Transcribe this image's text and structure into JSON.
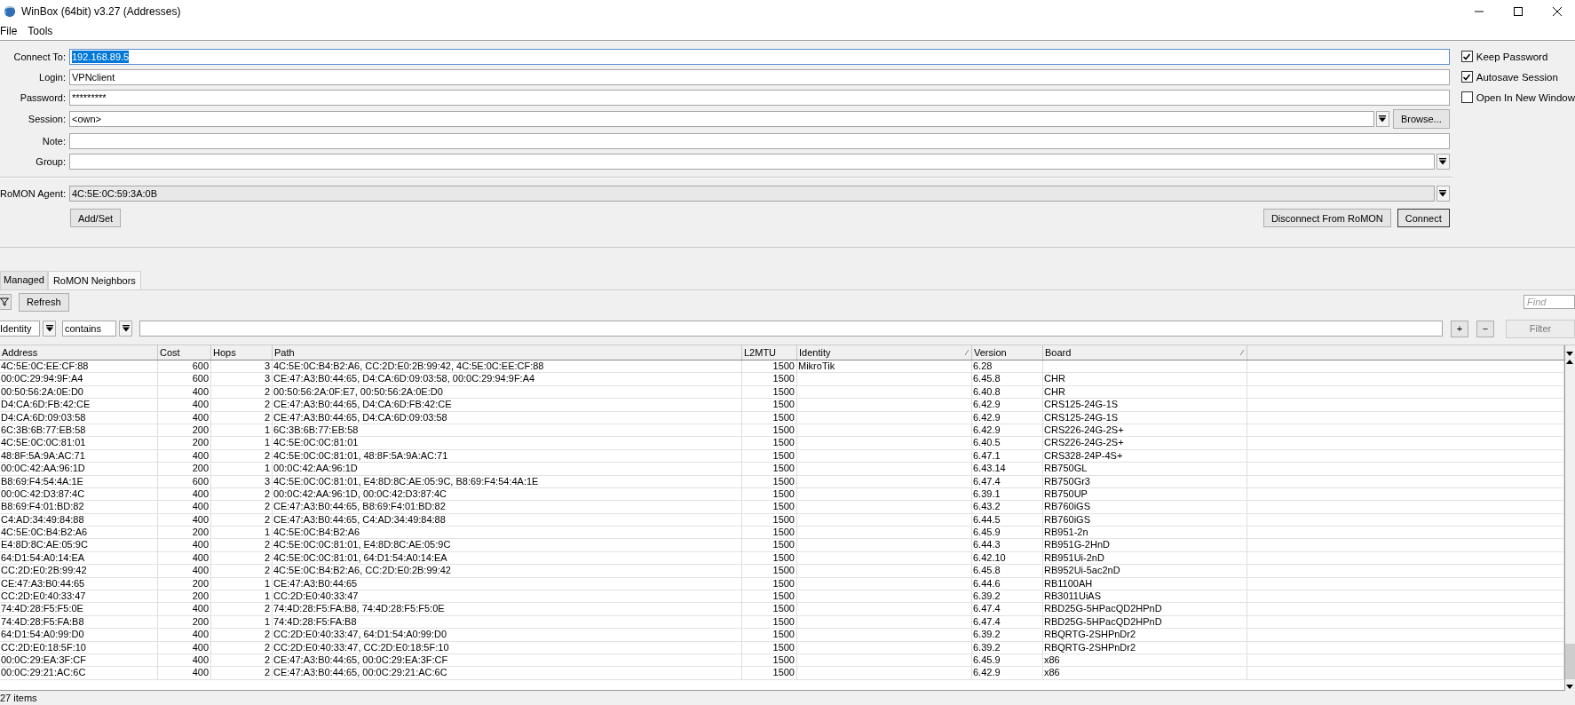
{
  "window": {
    "title": "WinBox (64bit) v3.27 (Addresses)"
  },
  "menu": [
    "File",
    "Tools"
  ],
  "form": {
    "fields": [
      {
        "label": "Connect To:",
        "value": "192.168.89.5",
        "kind": "text",
        "highlighted": true,
        "disabled": false
      },
      {
        "label": "Login:",
        "value": "VPNclient",
        "kind": "text",
        "highlighted": false,
        "disabled": false
      },
      {
        "label": "Password:",
        "value": "*********",
        "kind": "text",
        "highlighted": false,
        "disabled": false
      },
      {
        "label": "Session:",
        "value": "<own>",
        "kind": "browse",
        "button": "Browse...",
        "highlighted": false,
        "disabled": false
      },
      {
        "label": "Note:",
        "kind": "text",
        "highlighted": false,
        "disabled": false
      },
      {
        "label": "Group:",
        "kind": "dropdown",
        "highlighted": false,
        "disabled": false
      },
      {
        "label": "RoMON Agent:",
        "value": "4C:5E:0C:59:3A:0B",
        "kind": "dropdown",
        "highlighted": false,
        "disabled": true
      }
    ],
    "options": [
      {
        "label": "Keep Password",
        "checked": true
      },
      {
        "label": "Autosave Session",
        "checked": true
      },
      {
        "label": "Open In New Window",
        "checked": false
      }
    ],
    "left_buttons": [
      {
        "label": "Add/Set",
        "default": false
      }
    ],
    "right_buttons": [
      {
        "label": "Disconnect From RoMON",
        "default": false
      },
      {
        "label": "Connect",
        "default": true
      }
    ]
  },
  "tabs": [
    {
      "label": "Managed",
      "selected": false
    },
    {
      "label": "RoMON Neighbors",
      "selected": true
    }
  ],
  "toolbar": {
    "refresh": "Refresh",
    "find": {
      "placeholder": "Find"
    }
  },
  "filter": {
    "column": "Identity",
    "operator": "contains",
    "add": "+",
    "remove": "−",
    "apply": {
      "label": "Filter",
      "disabled": true
    }
  },
  "table": {
    "columns": [
      {
        "label": "Address",
        "sorted": false
      },
      {
        "label": "Cost",
        "sorted": false
      },
      {
        "label": "Hops",
        "sorted": false
      },
      {
        "label": "Path",
        "sorted": false
      },
      {
        "label": "L2MTU",
        "sorted": false
      },
      {
        "label": "Identity",
        "sorted": true
      },
      {
        "label": "Version",
        "sorted": false
      },
      {
        "label": "Board",
        "sorted": true
      }
    ],
    "rows": [
      [
        "4C:5E:0C:EE:CF:88",
        "600",
        "3",
        "4C:5E:0C:B4:B2:A6, CC:2D:E0:2B:99:42, 4C:5E:0C:EE:CF:88",
        "1500",
        "MikroTik",
        "6.28",
        ""
      ],
      [
        "00:0C:29:94:9F:A4",
        "600",
        "3",
        "CE:47:A3:B0:44:65, D4:CA:6D:09:03:58, 00:0C:29:94:9F:A4",
        "1500",
        "",
        "6.45.8",
        "CHR"
      ],
      [
        "00:50:56:2A:0E:D0",
        "400",
        "2",
        "00:50:56:2A:0F:E7, 00:50:56:2A:0E:D0",
        "1500",
        "",
        "6.40.8",
        "CHR"
      ],
      [
        "D4:CA:6D:FB:42:CE",
        "400",
        "2",
        "CE:47:A3:B0:44:65, D4:CA:6D:FB:42:CE",
        "1500",
        "",
        "6.42.9",
        "CRS125-24G-1S"
      ],
      [
        "D4:CA:6D:09:03:58",
        "400",
        "2",
        "CE:47:A3:B0:44:65, D4:CA:6D:09:03:58",
        "1500",
        "",
        "6.42.9",
        "CRS125-24G-1S"
      ],
      [
        "6C:3B:6B:77:EB:58",
        "200",
        "1",
        "6C:3B:6B:77:EB:58",
        "1500",
        "",
        "6.42.9",
        "CRS226-24G-2S+"
      ],
      [
        "4C:5E:0C:0C:81:01",
        "200",
        "1",
        "4C:5E:0C:0C:81:01",
        "1500",
        "",
        "6.40.5",
        "CRS226-24G-2S+"
      ],
      [
        "48:8F:5A:9A:AC:71",
        "400",
        "2",
        "4C:5E:0C:0C:81:01, 48:8F:5A:9A:AC:71",
        "1500",
        "",
        "6.47.1",
        "CRS328-24P-4S+"
      ],
      [
        "00:0C:42:AA:96:1D",
        "200",
        "1",
        "00:0C:42:AA:96:1D",
        "1500",
        "",
        "6.43.14",
        "RB750GL"
      ],
      [
        "B8:69:F4:54:4A:1E",
        "600",
        "3",
        "4C:5E:0C:0C:81:01, E4:8D:8C:AE:05:9C, B8:69:F4:54:4A:1E",
        "1500",
        "",
        "6.47.4",
        "RB750Gr3"
      ],
      [
        "00:0C:42:D3:87:4C",
        "400",
        "2",
        "00:0C:42:AA:96:1D, 00:0C:42:D3:87:4C",
        "1500",
        "",
        "6.39.1",
        "RB750UP"
      ],
      [
        "B8:69:F4:01:BD:82",
        "400",
        "2",
        "CE:47:A3:B0:44:65, B8:69:F4:01:BD:82",
        "1500",
        "",
        "6.43.2",
        "RB760iGS"
      ],
      [
        "C4:AD:34:49:84:88",
        "400",
        "2",
        "CE:47:A3:B0:44:65, C4:AD:34:49:84:88",
        "1500",
        "",
        "6.44.5",
        "RB760iGS"
      ],
      [
        "4C:5E:0C:B4:B2:A6",
        "200",
        "1",
        "4C:5E:0C:B4:B2:A6",
        "1500",
        "",
        "6.45.9",
        "RB951-2n"
      ],
      [
        "E4:8D:8C:AE:05:9C",
        "400",
        "2",
        "4C:5E:0C:0C:81:01, E4:8D:8C:AE:05:9C",
        "1500",
        "",
        "6.44.3",
        "RB951G-2HnD"
      ],
      [
        "64:D1:54:A0:14:EA",
        "400",
        "2",
        "4C:5E:0C:0C:81:01, 64:D1:54:A0:14:EA",
        "1500",
        "",
        "6.42.10",
        "RB951Ui-2nD"
      ],
      [
        "CC:2D:E0:2B:99:42",
        "400",
        "2",
        "4C:5E:0C:B4:B2:A6, CC:2D:E0:2B:99:42",
        "1500",
        "",
        "6.45.8",
        "RB952Ui-5ac2nD"
      ],
      [
        "CE:47:A3:B0:44:65",
        "200",
        "1",
        "CE:47:A3:B0:44:65",
        "1500",
        "",
        "6.44.6",
        "RB1100AH"
      ],
      [
        "CC:2D:E0:40:33:47",
        "200",
        "1",
        "CC:2D:E0:40:33:47",
        "1500",
        "",
        "6.39.2",
        "RB3011UiAS"
      ],
      [
        "74:4D:28:F5:F5:0E",
        "400",
        "2",
        "74:4D:28:F5:FA:B8, 74:4D:28:F5:F5:0E",
        "1500",
        "",
        "6.47.4",
        "RBD25G-5HPacQD2HPnD"
      ],
      [
        "74:4D:28:F5:FA:B8",
        "200",
        "1",
        "74:4D:28:F5:FA:B8",
        "1500",
        "",
        "6.47.4",
        "RBD25G-5HPacQD2HPnD"
      ],
      [
        "64:D1:54:A0:99:D0",
        "400",
        "2",
        "CC:2D:E0:40:33:47, 64:D1:54:A0:99:D0",
        "1500",
        "",
        "6.39.2",
        "RBQRTG-2SHPnDr2"
      ],
      [
        "CC:2D:E0:18:5F:10",
        "400",
        "2",
        "CC:2D:E0:40:33:47, CC:2D:E0:18:5F:10",
        "1500",
        "",
        "6.39.2",
        "RBQRTG-2SHPnDr2"
      ],
      [
        "00:0C:29:EA:3F:CF",
        "400",
        "2",
        "CE:47:A3:B0:44:65, 00:0C:29:EA:3F:CF",
        "1500",
        "",
        "6.45.9",
        "x86"
      ],
      [
        "00:0C:29:21:AC:6C",
        "400",
        "2",
        "CE:47:A3:B0:44:65, 00:0C:29:21:AC:6C",
        "1500",
        "",
        "6.42.9",
        "x86"
      ]
    ]
  },
  "status_bar": "27 items"
}
